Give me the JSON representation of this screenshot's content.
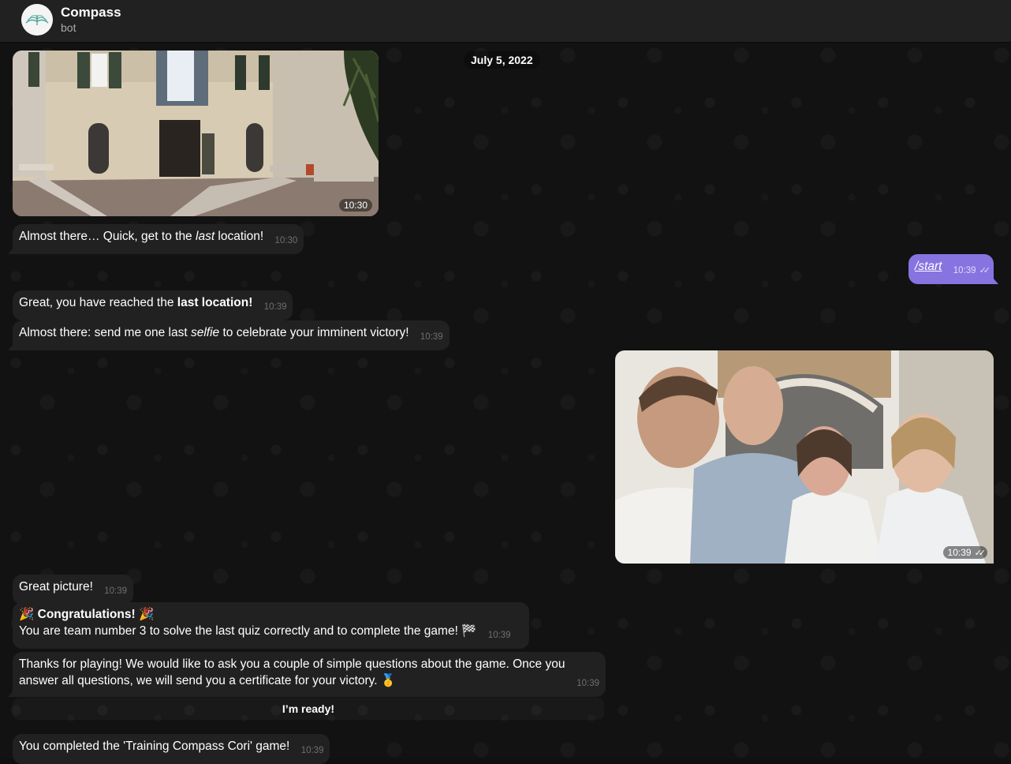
{
  "header": {
    "title": "Compass",
    "subtitle": "bot"
  },
  "date_separator": "July 5, 2022",
  "messages": {
    "m1_photo_time": "10:30",
    "m2_pre": "Almost there… Quick, get to the ",
    "m2_em": "last",
    "m2_post": " location!",
    "m2_time": "10:30",
    "m3_link": "/start",
    "m3_time": "10:39",
    "m4_pre": "Great, you have reached the ",
    "m4_bold": "last location!",
    "m4_time": "10:39",
    "m5_pre": "Almost there: send me one last ",
    "m5_em": "selfie",
    "m5_post": " to celebrate your imminent victory!",
    "m5_time": "10:39",
    "m6_photo_time": "10:39",
    "m7_text": "Great picture!",
    "m7_time": "10:39",
    "m8_title": "Congratulations!",
    "m8_body": "You are team number 3 to solve the last quiz correctly and to complete the game! 🏁",
    "m8_time": "10:39",
    "m9_line1": "Thanks for playing! We would like to ask you a couple of simple questions about the game. Once you",
    "m9_line2": "answer all questions, we will send you a certificate for your victory. 🥇",
    "m9_time": "10:39",
    "keyboard_button": "I’m ready!",
    "m10_text": "You completed the 'Training Compass Cori' game!",
    "m10_time": "10:39"
  },
  "icons": {
    "party": "party-popper-icon",
    "read": "double-check-icon"
  },
  "colors": {
    "outgoing": "#8774e1",
    "incoming": "#212121",
    "header": "#212121"
  }
}
